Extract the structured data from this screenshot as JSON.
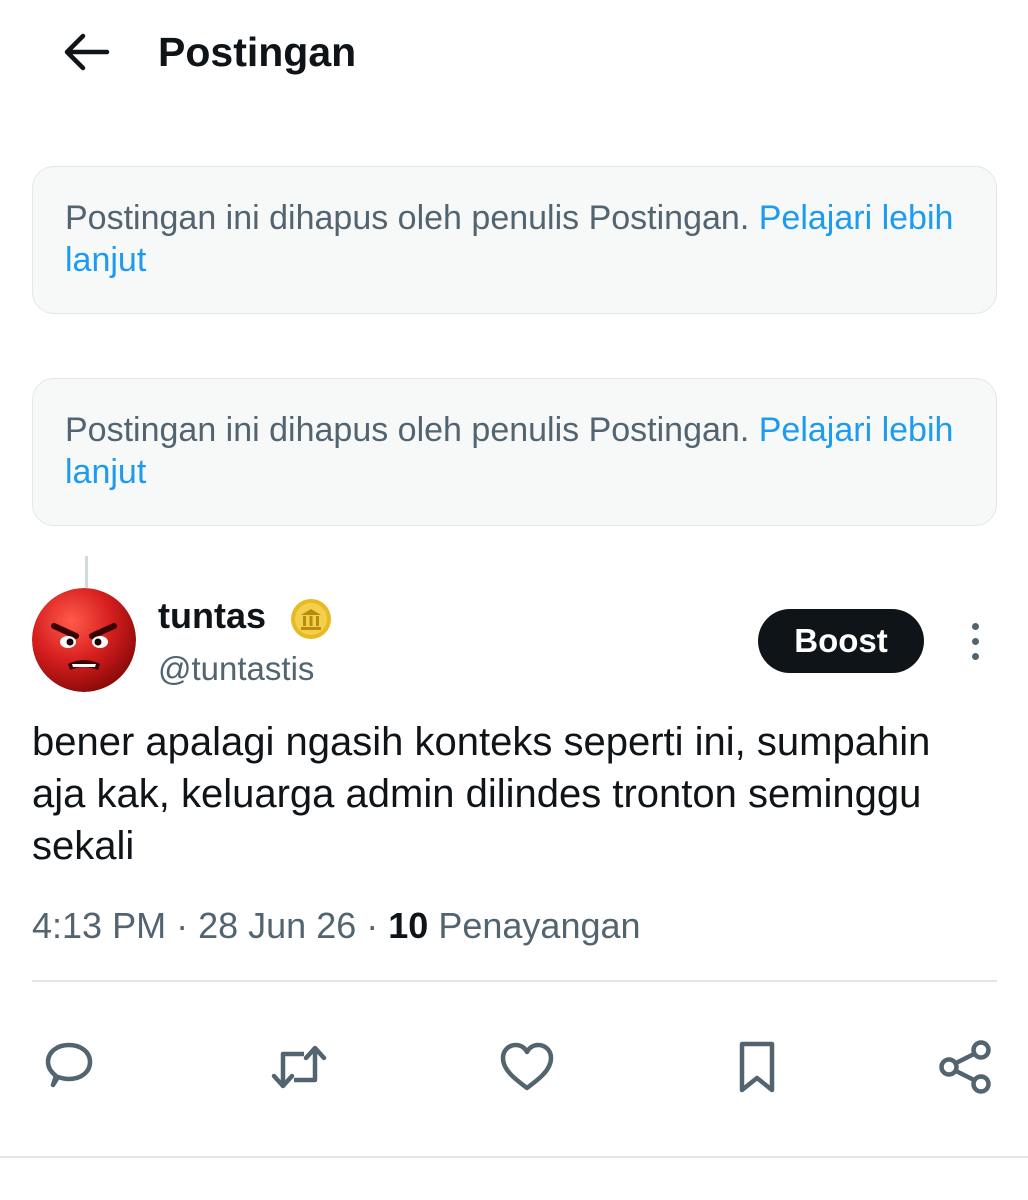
{
  "header": {
    "title": "Postingan",
    "back_icon": "arrow-left-icon"
  },
  "deleted_posts": [
    {
      "message": "Postingan ini dihapus oleh penulis Postingan.",
      "link": "Pelajari lebih lanjut"
    },
    {
      "message": "Postingan ini dihapus oleh penulis Postingan.",
      "link": "Pelajari lebih lanjut"
    }
  ],
  "post": {
    "author": {
      "display_name": "tuntas",
      "handle": "@tuntastis",
      "badge_icon": "gold-verified-badge-icon",
      "avatar_icon": "angry-face-avatar"
    },
    "boost_label": "Boost",
    "text": "bener apalagi ngasih konteks seperti ini, sumpahin aja kak, keluarga admin dilindes tronton seminggu sekali",
    "time": "4:13 PM",
    "separator": "·",
    "date": "28 Jun 26",
    "views_count": "10",
    "views_label": "Penayangan"
  },
  "actions": [
    {
      "name": "reply",
      "icon": "reply-icon"
    },
    {
      "name": "repost",
      "icon": "repost-icon"
    },
    {
      "name": "like",
      "icon": "heart-icon"
    },
    {
      "name": "bookmark",
      "icon": "bookmark-icon"
    },
    {
      "name": "share",
      "icon": "share-icon"
    }
  ],
  "colors": {
    "text": "#0f1419",
    "secondary": "#536471",
    "link": "#1d9bf0",
    "card_bg": "#f7f9f9",
    "border": "#e1e6ea",
    "boost_bg": "#0f1419",
    "avatar_red": "#d61f1f"
  }
}
